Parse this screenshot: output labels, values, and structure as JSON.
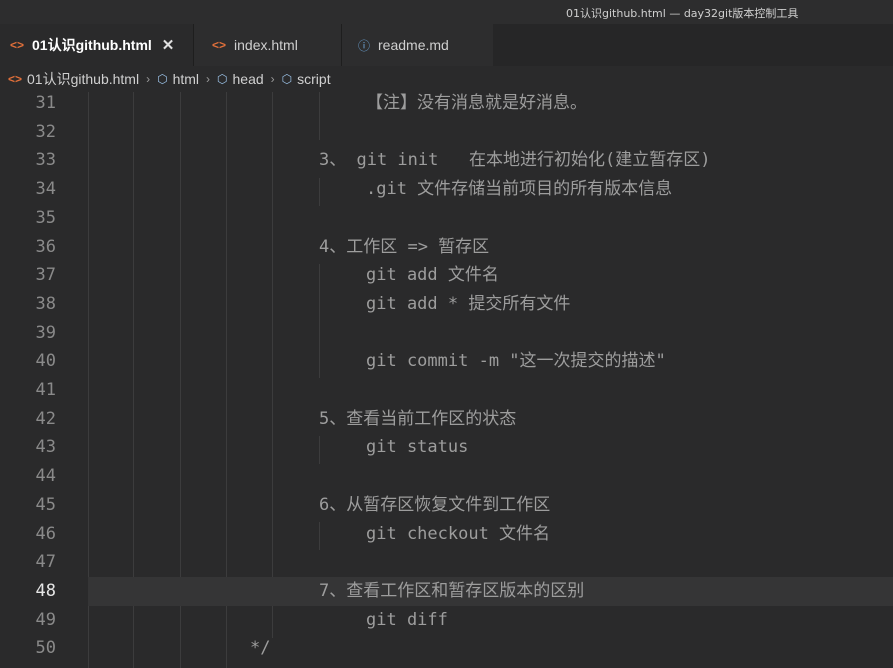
{
  "window": {
    "title": "01认识github.html — day32git版本控制工具"
  },
  "tabs": [
    {
      "label": "01认识github.html",
      "icon": "html-code-icon",
      "active": true,
      "close": "✕"
    },
    {
      "label": "index.html",
      "icon": "html-code-icon",
      "active": false
    },
    {
      "label": "readme.md",
      "icon": "info-icon",
      "active": false
    }
  ],
  "breadcrumb": {
    "items": [
      {
        "label": "01认识github.html",
        "icon": "html-code-icon"
      },
      {
        "label": "html",
        "icon": "cube-icon"
      },
      {
        "label": "head",
        "icon": "cube-icon"
      },
      {
        "label": "script",
        "icon": "cube-icon"
      }
    ]
  },
  "editor": {
    "current_line": "48",
    "lines": [
      {
        "num": "31",
        "text": "【注】没有消息就是好消息。"
      },
      {
        "num": "32",
        "text": ""
      },
      {
        "num": "33",
        "text": "3、 git init   在本地进行初始化(建立暂存区)"
      },
      {
        "num": "34",
        "text": ".git 文件存储当前项目的所有版本信息"
      },
      {
        "num": "35",
        "text": ""
      },
      {
        "num": "36",
        "text": "4、工作区 => 暂存区"
      },
      {
        "num": "37",
        "text": "git add 文件名"
      },
      {
        "num": "38",
        "text": "git add * 提交所有文件"
      },
      {
        "num": "39",
        "text": ""
      },
      {
        "num": "40",
        "text": "git commit -m \"这一次提交的描述\""
      },
      {
        "num": "41",
        "text": ""
      },
      {
        "num": "42",
        "text": "5、查看当前工作区的状态"
      },
      {
        "num": "43",
        "text": "git status"
      },
      {
        "num": "44",
        "text": ""
      },
      {
        "num": "45",
        "text": "6、从暂存区恢复文件到工作区"
      },
      {
        "num": "46",
        "text": "git checkout 文件名"
      },
      {
        "num": "47",
        "text": ""
      },
      {
        "num": "48",
        "text": "7、查看工作区和暂存区版本的区别"
      },
      {
        "num": "49",
        "text": "git diff"
      },
      {
        "num": "50",
        "text": "*/"
      }
    ]
  },
  "colors": {
    "editor_bg": "#2a2a2b",
    "current_line_bg": "#353536",
    "code_text": "#9d9d9d",
    "tab_icon": "#e2703a",
    "info_icon": "#6fa8dc",
    "cube_icon": "#9cc3e8"
  }
}
